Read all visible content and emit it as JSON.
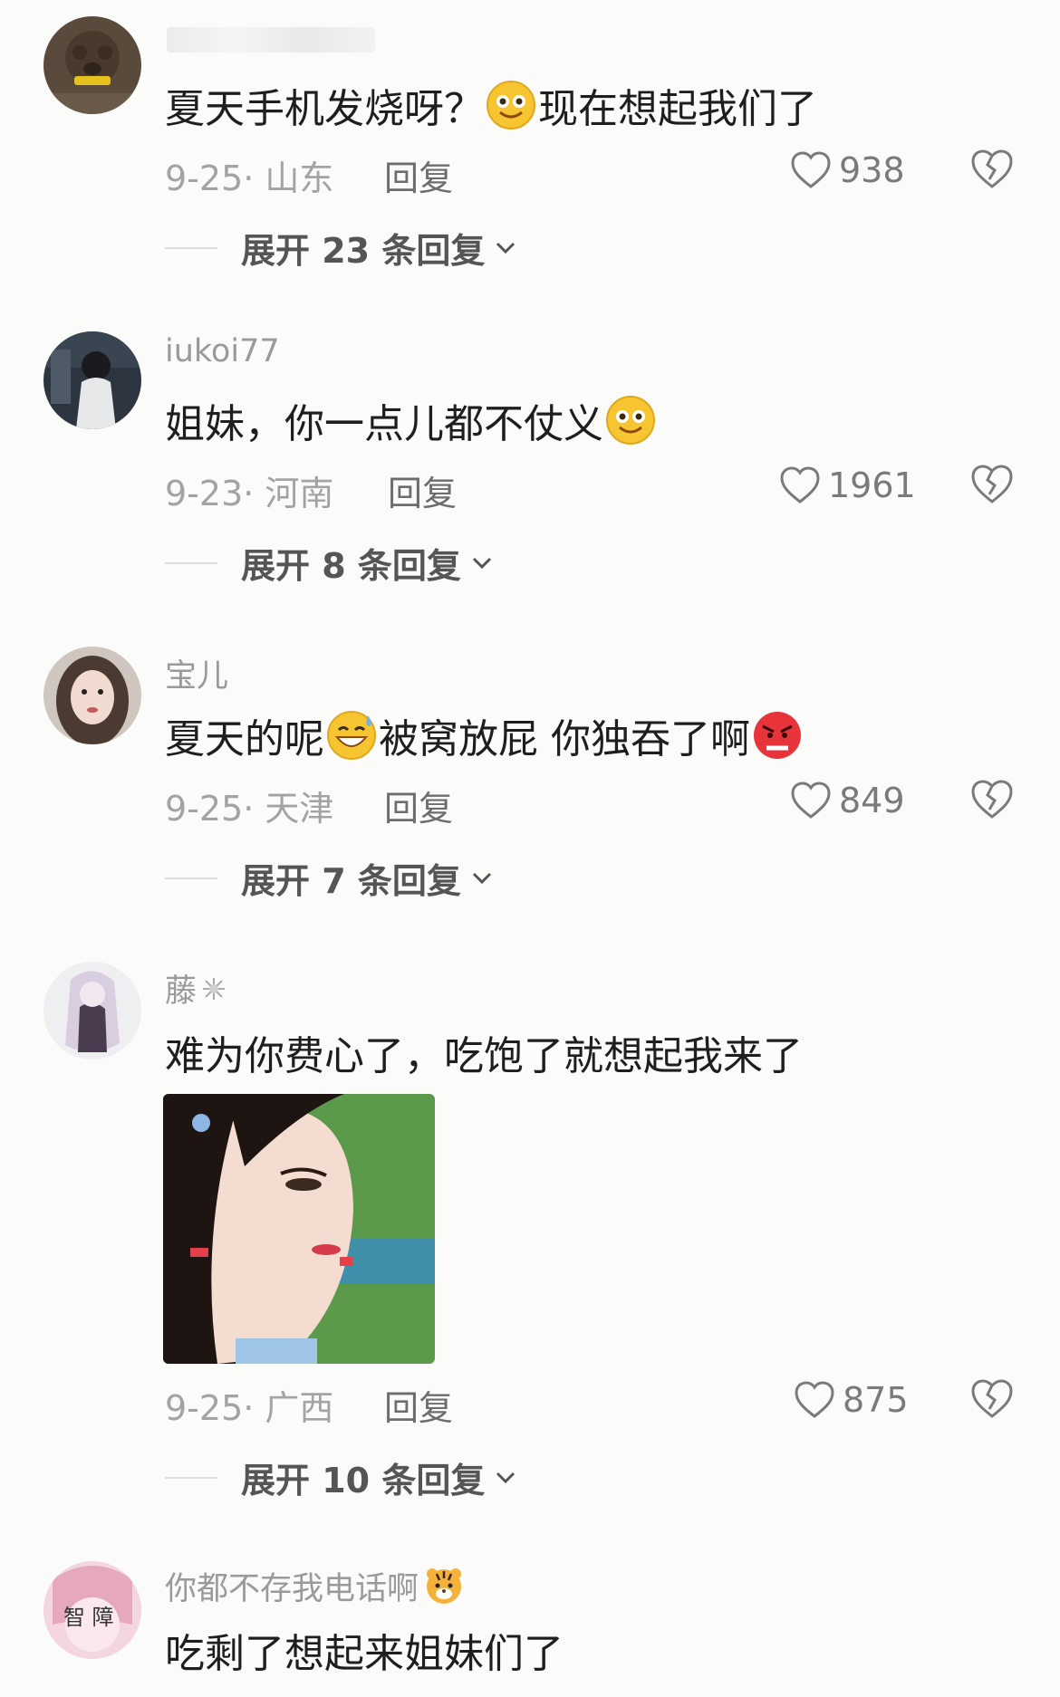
{
  "comments": [
    {
      "username": "",
      "text_before": "夏天手机发烧呀？",
      "text_after": "现在想起我们了",
      "date_loc": "9-25· 山东",
      "reply_label": "回复",
      "likes": "938",
      "expand_label": "展开 23 条回复",
      "emoji": [
        "smile-emoji"
      ]
    },
    {
      "username": "iukoi77",
      "text_before": "姐妹，你一点儿都不仗义",
      "text_after": "",
      "date_loc": "9-23· 河南",
      "reply_label": "回复",
      "likes": "1961",
      "expand_label": "展开 8 条回复",
      "emoji": [
        "smile-emoji"
      ]
    },
    {
      "username": "宝儿",
      "text_before": "夏天的呢",
      "text_middle": "被窝放屁 你独吞了啊",
      "text_after": "",
      "date_loc": "9-25· 天津",
      "reply_label": "回复",
      "likes": "849",
      "expand_label": "展开 7 条回复",
      "emoji": [
        "sweat-smile-emoji",
        "angry-emoji"
      ]
    },
    {
      "username": "藤",
      "text_before": "难为你费心了，吃饱了就想起我来了",
      "text_after": "",
      "date_loc": "9-25· 广西",
      "reply_label": "回复",
      "likes": "875",
      "expand_label": "展开 10 条回复",
      "emoji": [
        "sparkle-icon"
      ]
    },
    {
      "username": "你都不存我电话啊",
      "text_before": "吃剩了想起来姐妹们了",
      "text_after": "",
      "emoji": [
        "tiger-emoji"
      ],
      "avatar_text": "智 障"
    }
  ],
  "colors": {
    "background": "#fbfbfa",
    "meta": "#a3a3a3",
    "text": "#1e1e1e"
  }
}
